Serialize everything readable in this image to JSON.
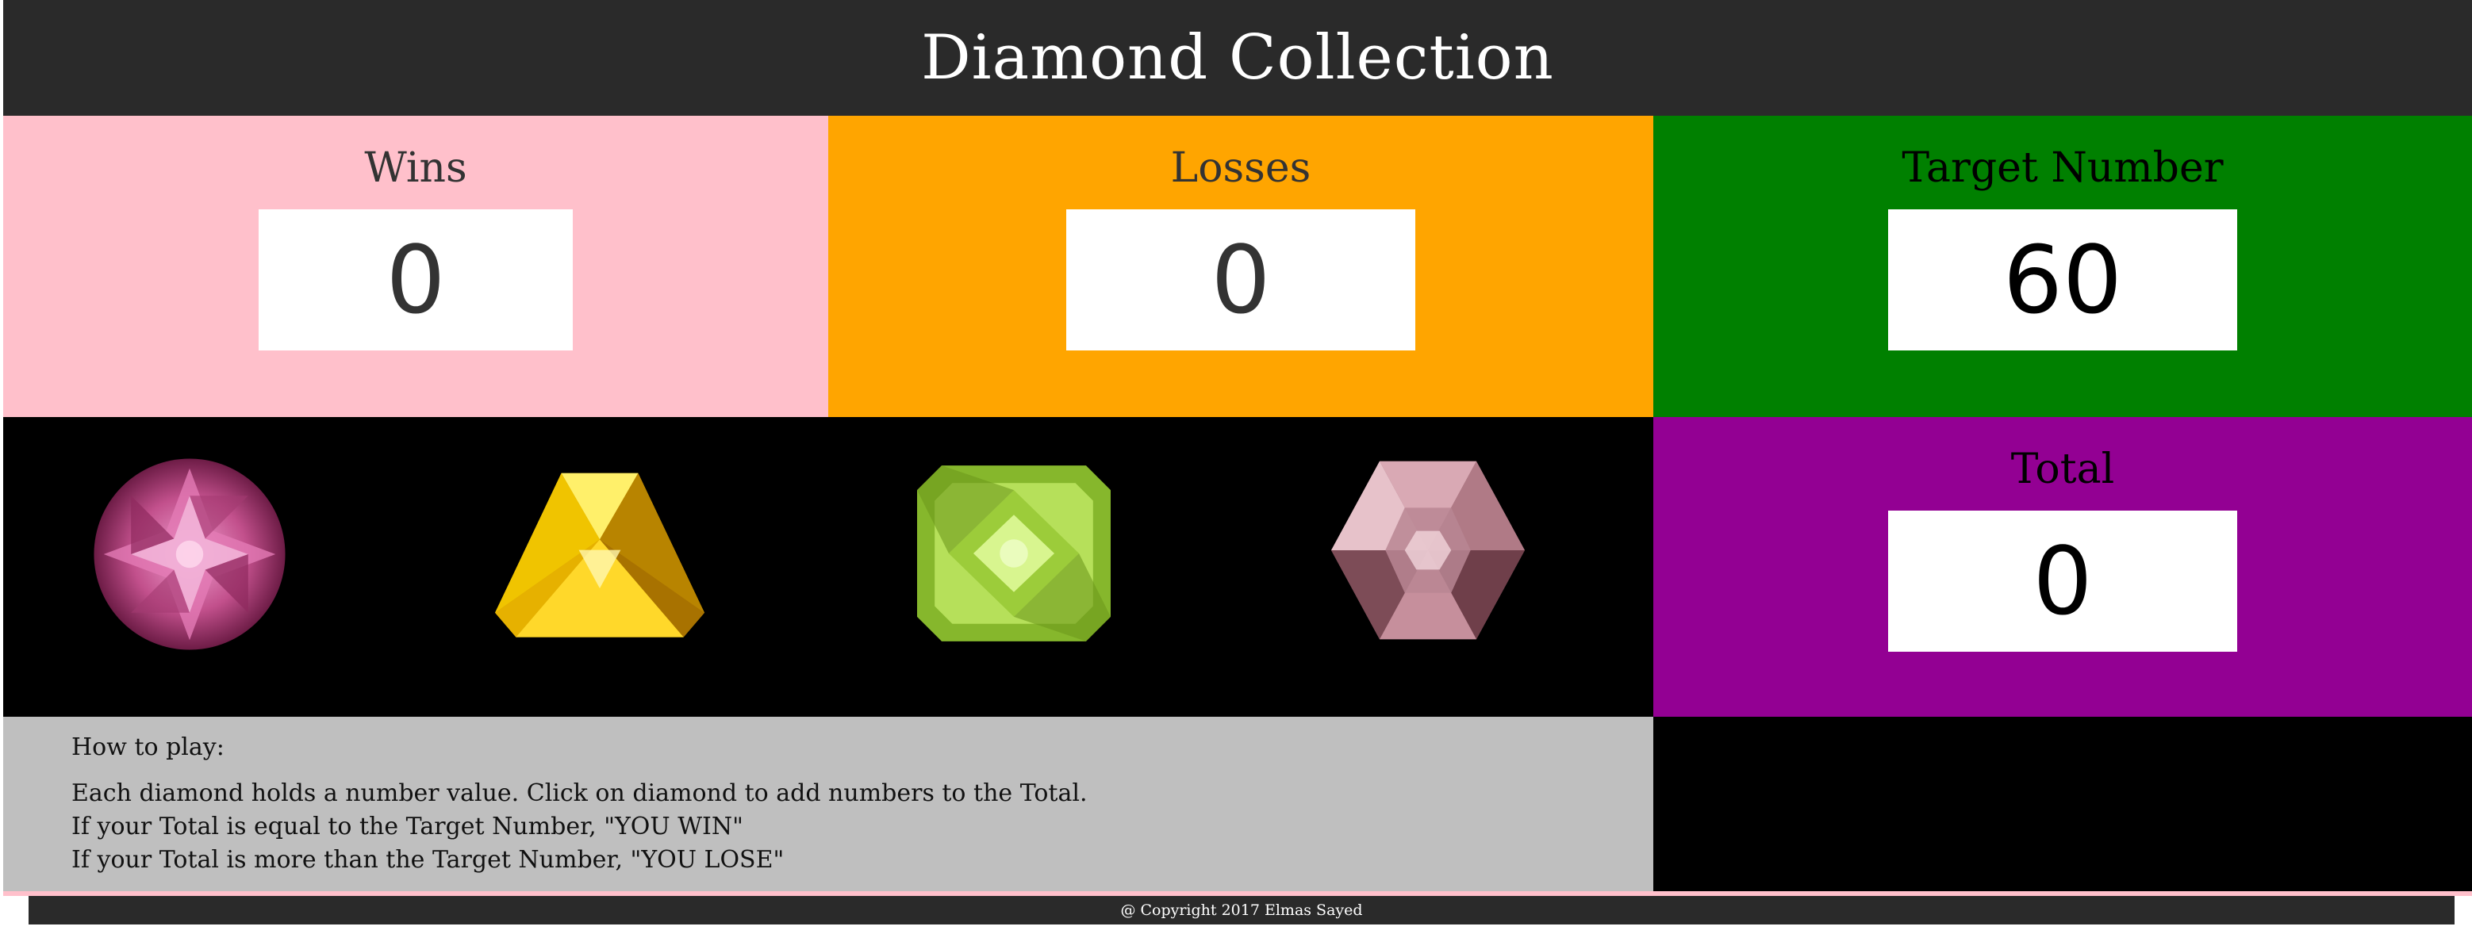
{
  "header": {
    "title": "Diamond Collection"
  },
  "scoreboard": {
    "wins": {
      "label": "Wins",
      "value": "0"
    },
    "losses": {
      "label": "Losses",
      "value": "0"
    },
    "target": {
      "label": "Target Number",
      "value": "60"
    },
    "total": {
      "label": "Total",
      "value": "0"
    }
  },
  "diamonds": [
    {
      "name": "pink-round-diamond",
      "color": "#c5508f"
    },
    {
      "name": "yellow-trillion-diamond",
      "color": "#e0b400"
    },
    {
      "name": "green-cushion-diamond",
      "color": "#9ccc3a"
    },
    {
      "name": "rose-hexagon-diamond",
      "color": "#b7838f"
    }
  ],
  "instructions": {
    "title": "How to play:",
    "lines": [
      "Each diamond holds a number value. Click on diamond to add numbers to the Total.",
      "If your Total is equal to the Target Number, \"YOU WIN\"",
      "If your Total is more than the Target Number, \"YOU LOSE\""
    ]
  },
  "footer": {
    "copyright": "@ Copyright 2017 Elmas Sayed"
  }
}
